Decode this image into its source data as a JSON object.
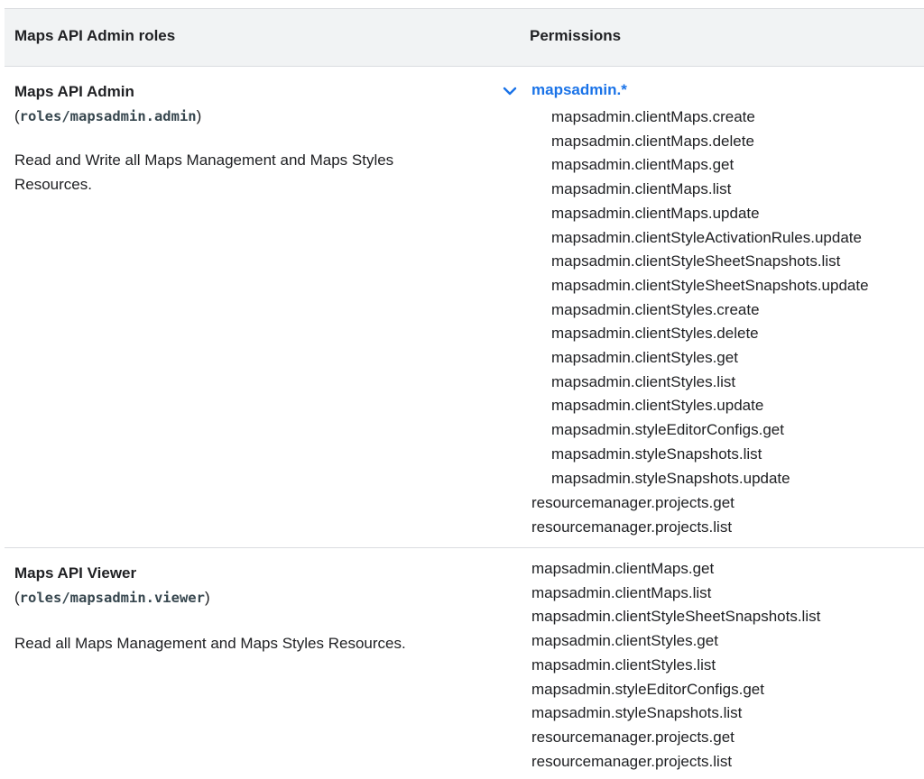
{
  "header": {
    "col_roles": "Maps API Admin roles",
    "col_permissions": "Permissions"
  },
  "admin": {
    "name": "Maps API Admin",
    "id_prefix": "(",
    "id": "roles/mapsadmin.admin",
    "id_suffix": ")",
    "description": "Read and Write all Maps Management and Maps Styles Resources.",
    "group_label": "mapsadmin.*",
    "group_expanded": true,
    "group_permissions": [
      "mapsadmin.clientMaps.create",
      "mapsadmin.clientMaps.delete",
      "mapsadmin.clientMaps.get",
      "mapsadmin.clientMaps.list",
      "mapsadmin.clientMaps.update",
      "mapsadmin.clientStyleActivationRules.update",
      "mapsadmin.clientStyleSheetSnapshots.list",
      "mapsadmin.clientStyleSheetSnapshots.update",
      "mapsadmin.clientStyles.create",
      "mapsadmin.clientStyles.delete",
      "mapsadmin.clientStyles.get",
      "mapsadmin.clientStyles.list",
      "mapsadmin.clientStyles.update",
      "mapsadmin.styleEditorConfigs.get",
      "mapsadmin.styleSnapshots.list",
      "mapsadmin.styleSnapshots.update"
    ],
    "other_permissions": [
      "resourcemanager.projects.get",
      "resourcemanager.projects.list"
    ]
  },
  "viewer": {
    "name": "Maps API Viewer",
    "id_prefix": "(",
    "id": "roles/mapsadmin.viewer",
    "id_suffix": ")",
    "description": "Read all Maps Management and Maps Styles Resources.",
    "permissions": [
      "mapsadmin.clientMaps.get",
      "mapsadmin.clientMaps.list",
      "mapsadmin.clientStyleSheetSnapshots.list",
      "mapsadmin.clientStyles.get",
      "mapsadmin.clientStyles.list",
      "mapsadmin.styleEditorConfigs.get",
      "mapsadmin.styleSnapshots.list",
      "resourcemanager.projects.get",
      "resourcemanager.projects.list"
    ]
  },
  "colors": {
    "link": "#1a73e8",
    "header_bg": "#f1f3f4",
    "divider": "#dadce0",
    "text": "#202124",
    "code": "#37474f"
  }
}
